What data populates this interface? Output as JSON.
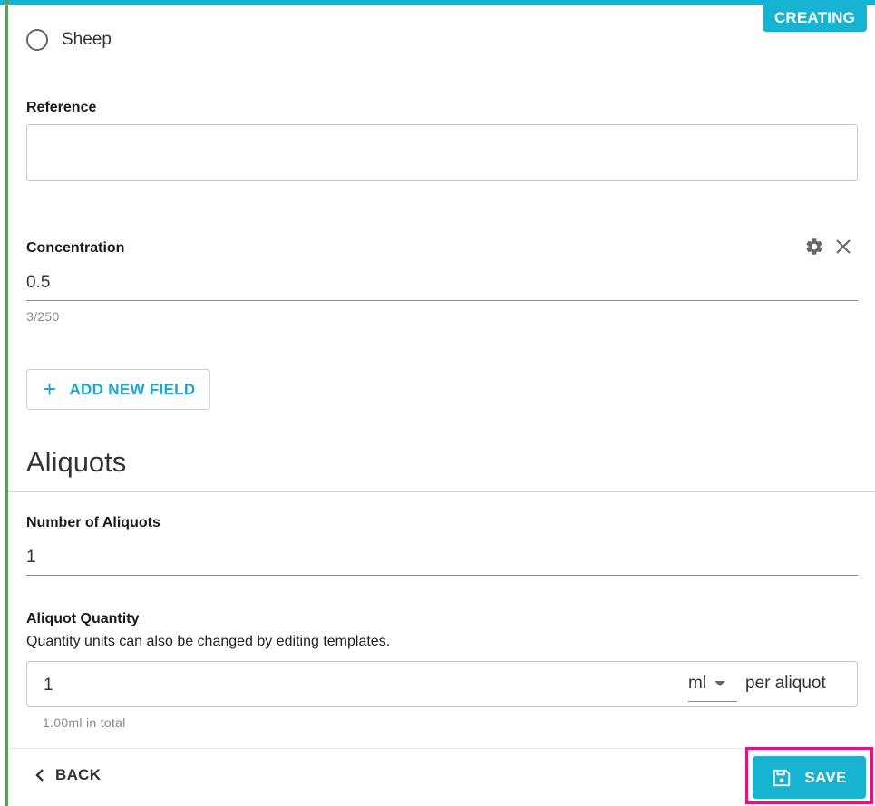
{
  "status": {
    "badge": "CREATING",
    "color": "#17b3d1"
  },
  "radio_option": {
    "label": "Sheep"
  },
  "reference": {
    "label": "Reference",
    "value": ""
  },
  "concentration": {
    "label": "Concentration",
    "value": "0.5",
    "char_count": "3/250",
    "icons": [
      "gear-icon",
      "close-icon"
    ]
  },
  "add_field": {
    "label": "ADD NEW FIELD",
    "icon": "plus-icon"
  },
  "aliquots": {
    "title": "Aliquots",
    "number_label": "Number of Aliquots",
    "number_value": "1",
    "quantity_label": "Aliquot Quantity",
    "quantity_note": "Quantity units can also be changed by editing templates.",
    "quantity_value": "1",
    "unit": "ml",
    "per_label": "per aliquot",
    "total": "1.00ml in total"
  },
  "footer": {
    "back_label": "BACK",
    "save_label": "SAVE"
  },
  "colors": {
    "accent": "#17b3d1",
    "left_bar": "#5b9b5e",
    "highlight": "#e8127a"
  }
}
